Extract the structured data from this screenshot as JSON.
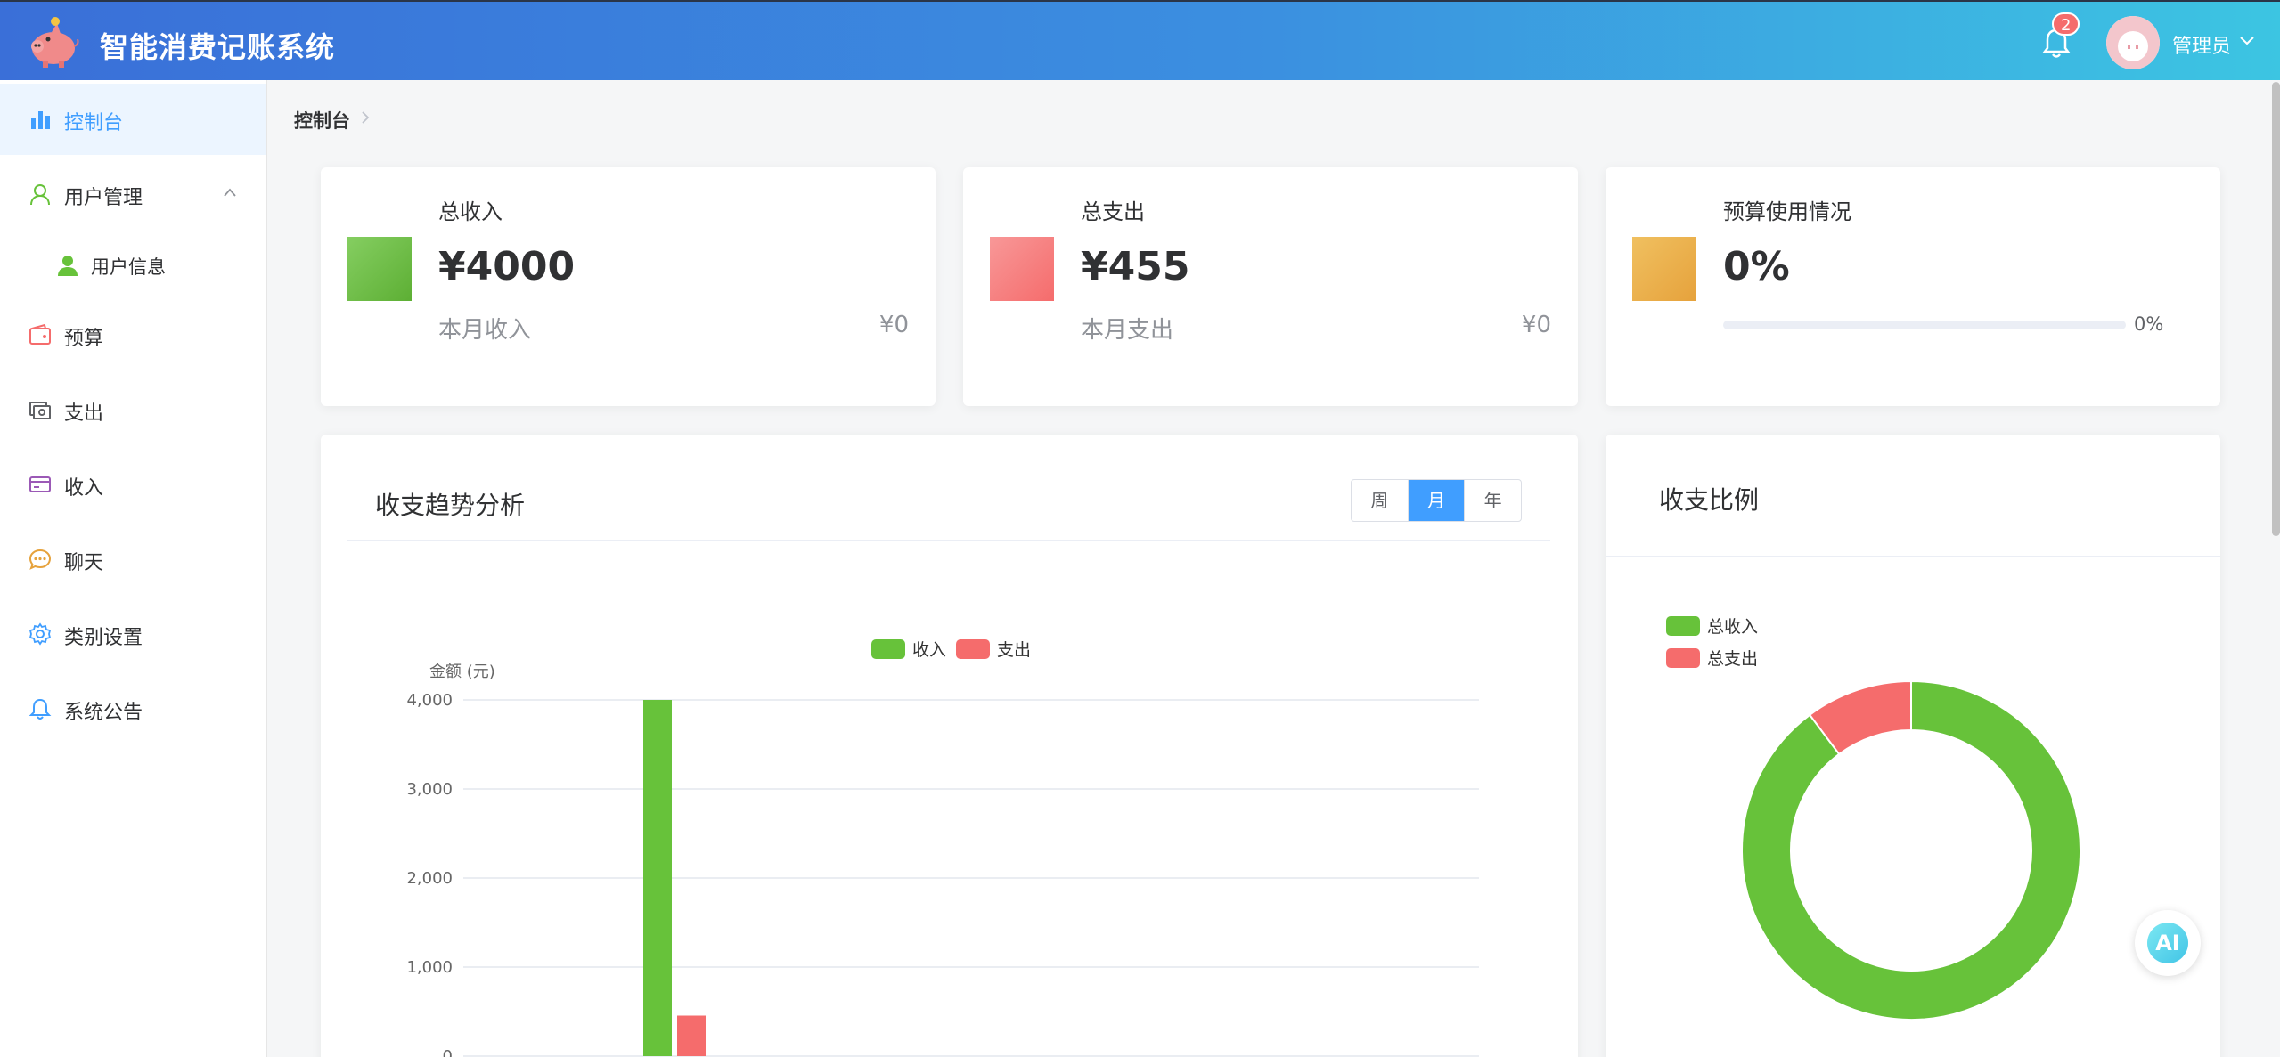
{
  "app": {
    "title": "智能消费记账系统"
  },
  "header": {
    "notification_count": "2",
    "user_name": "管理员"
  },
  "sidebar": {
    "items": [
      {
        "label": "控制台",
        "icon": "bar-chart-icon"
      },
      {
        "label": "用户管理",
        "icon": "user-icon"
      },
      {
        "label": "用户信息",
        "icon": "user-filled-icon"
      },
      {
        "label": "预算",
        "icon": "wallet-icon"
      },
      {
        "label": "支出",
        "icon": "money-icon"
      },
      {
        "label": "收入",
        "icon": "credit-card-icon"
      },
      {
        "label": "聊天",
        "icon": "chat-icon"
      },
      {
        "label": "类别设置",
        "icon": "gear-icon"
      },
      {
        "label": "系统公告",
        "icon": "bell-icon"
      }
    ]
  },
  "breadcrumb": {
    "current": "控制台"
  },
  "stats": {
    "income": {
      "title": "总收入",
      "value": "¥4000",
      "sub_label": "本月收入",
      "sub_value": "¥0",
      "color": "#67c23a"
    },
    "expense": {
      "title": "总支出",
      "value": "¥455",
      "sub_label": "本月支出",
      "sub_value": "¥0",
      "color": "#f56c6c"
    },
    "budget": {
      "title": "预算使用情况",
      "value": "0%",
      "progress": 0,
      "progress_text": "0%",
      "color": "#e6a23c"
    }
  },
  "trend": {
    "title": "收支趋势分析",
    "periods": [
      "周",
      "月",
      "年"
    ],
    "active_period": "月"
  },
  "ratio": {
    "title": "收支比例"
  },
  "ai": {
    "label": "AI"
  },
  "chart_data": [
    {
      "type": "bar",
      "categories": [
        ""
      ],
      "series": [
        {
          "name": "收入",
          "values": [
            4000
          ],
          "color": "#67c23a"
        },
        {
          "name": "支出",
          "values": [
            455
          ],
          "color": "#f56c6c"
        }
      ],
      "ylabel": "金额 (元)",
      "ylim": [
        0,
        4000
      ],
      "yticks": [
        "0",
        "1,000",
        "2,000",
        "3,000",
        "4,000"
      ],
      "grid": true,
      "legend": "top-center"
    },
    {
      "type": "pie",
      "donut": true,
      "slices": [
        {
          "name": "总收入",
          "value": 4000,
          "color": "#67c23a"
        },
        {
          "name": "总支出",
          "value": 455,
          "color": "#f56c6c"
        }
      ],
      "legend": "top-left"
    }
  ]
}
